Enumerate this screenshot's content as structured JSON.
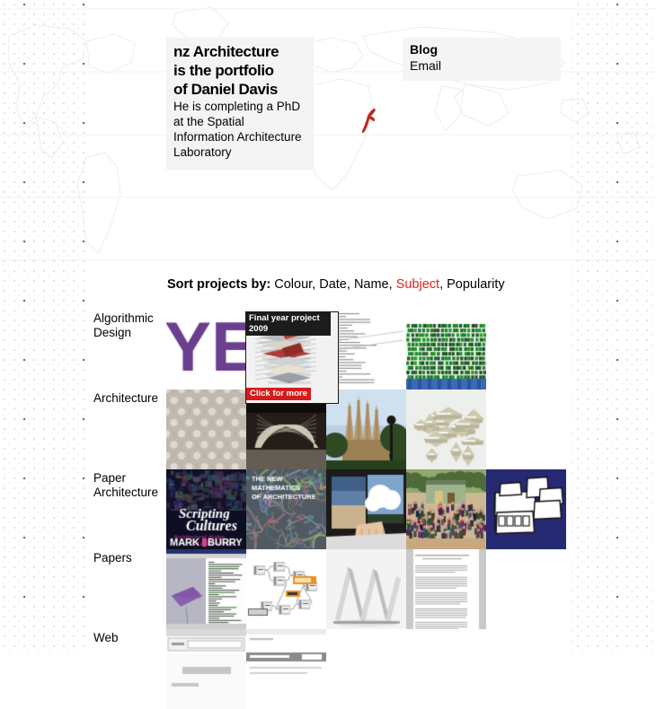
{
  "site": {
    "intro_line1": "nz Architecture",
    "intro_line2": "is the portfolio",
    "intro_line3": "of Daniel Davis",
    "intro_sub": "He is completing a PhD at the Spatial Information Architecture Laboratory",
    "map_marker": "new-zealand-marker"
  },
  "links": {
    "blog": "Blog",
    "email": "Email"
  },
  "sort": {
    "lead": "Sort projects by:",
    "options": [
      "Colour",
      "Date",
      "Name",
      "Subject",
      "Popularity"
    ],
    "active": "Subject",
    "active_color": "#e02020"
  },
  "hover_card": {
    "title": "Final year project 2009",
    "cta": "Click for more"
  },
  "categories": [
    {
      "label": "Algorithmic Design",
      "label_line1": "Algorithmic",
      "label_line2": "Design",
      "thumbs": [
        {
          "name": "yeti-poster",
          "kind": "yeti"
        },
        {
          "name": "final-year-project-2009",
          "kind": "hovered"
        },
        {
          "name": "text-diagram-sheet",
          "kind": "textsheet"
        },
        {
          "name": "green-crowd-render",
          "kind": "greencrowd"
        }
      ]
    },
    {
      "label": "Architecture",
      "label_line1": "Architecture",
      "label_line2": "",
      "thumbs": [
        {
          "name": "hexagon-panel-facade",
          "kind": "hexpanel"
        },
        {
          "name": "timber-gridshell",
          "kind": "gridshell"
        },
        {
          "name": "sagrada-familia",
          "kind": "sagrada"
        },
        {
          "name": "massing-model-aerial",
          "kind": "massing"
        }
      ]
    },
    {
      "label": "Paper Architecture",
      "label_line1": "Paper",
      "label_line2": "Architecture",
      "thumbs": [
        {
          "name": "scripting-cultures-book",
          "kind": "scripting"
        },
        {
          "name": "new-mathematics-of-architecture-book",
          "kind": "newmaths"
        },
        {
          "name": "open-book-landscape",
          "kind": "openbook"
        },
        {
          "name": "group-photo-house",
          "kind": "groupphoto"
        },
        {
          "name": "blue-sketch-drawing",
          "kind": "bluesketch"
        }
      ]
    },
    {
      "label": "Papers",
      "label_line1": "Papers",
      "label_line2": "",
      "thumbs": [
        {
          "name": "cad-software-screenshot",
          "kind": "cadscreen"
        },
        {
          "name": "grasshopper-node-graph",
          "kind": "nodegraph"
        },
        {
          "name": "folded-zigzag-model",
          "kind": "zigzag"
        },
        {
          "name": "academic-paper-page",
          "kind": "paperpage"
        }
      ]
    },
    {
      "label": "Web",
      "label_line1": "Web",
      "label_line2": "",
      "thumbs": [
        {
          "name": "web-interface-screenshot-a",
          "kind": "webshot1"
        },
        {
          "name": "web-interface-screenshot-b",
          "kind": "webshot2"
        }
      ]
    }
  ],
  "book_text": {
    "scripting_title1": "Scripting",
    "scripting_title2": "Cultures",
    "scripting_sub1": "Architectural design",
    "scripting_sub2": "and programming",
    "scripting_author": "MARK BURRY",
    "newmaths_l1": "THE NEW",
    "newmaths_l2": "MATHEMATICS",
    "newmaths_l3": "OF ARCHITECTURE",
    "yeti": "YETI"
  }
}
